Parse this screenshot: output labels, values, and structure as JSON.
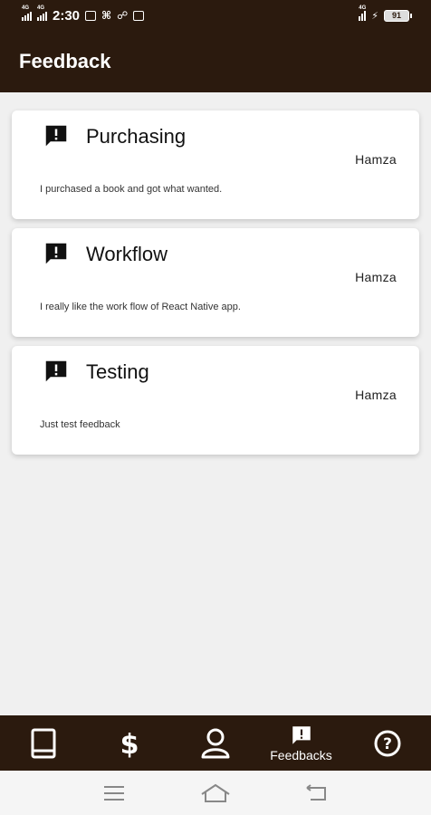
{
  "status_bar": {
    "time": "2:30",
    "battery": "91",
    "net_labels": [
      "4G",
      "4G",
      "4G"
    ]
  },
  "header": {
    "title": "Feedback"
  },
  "feedbacks": [
    {
      "title": "Purchasing",
      "author": "Hamza",
      "body": "I purchased a book and got what wanted."
    },
    {
      "title": "Workflow",
      "author": "Hamza",
      "body": "I really like the work flow of React Native app."
    },
    {
      "title": "Testing",
      "author": "Hamza",
      "body": "Just test feedback"
    }
  ],
  "bottom_nav": {
    "items": [
      {
        "icon": "book-icon"
      },
      {
        "icon": "dollar-icon"
      },
      {
        "icon": "user-icon"
      },
      {
        "icon": "feedback-icon",
        "label": "Feedbacks"
      },
      {
        "icon": "help-icon"
      }
    ]
  },
  "colors": {
    "primary": "#2b1a0e",
    "background": "#f0f0f0",
    "card": "#ffffff"
  }
}
